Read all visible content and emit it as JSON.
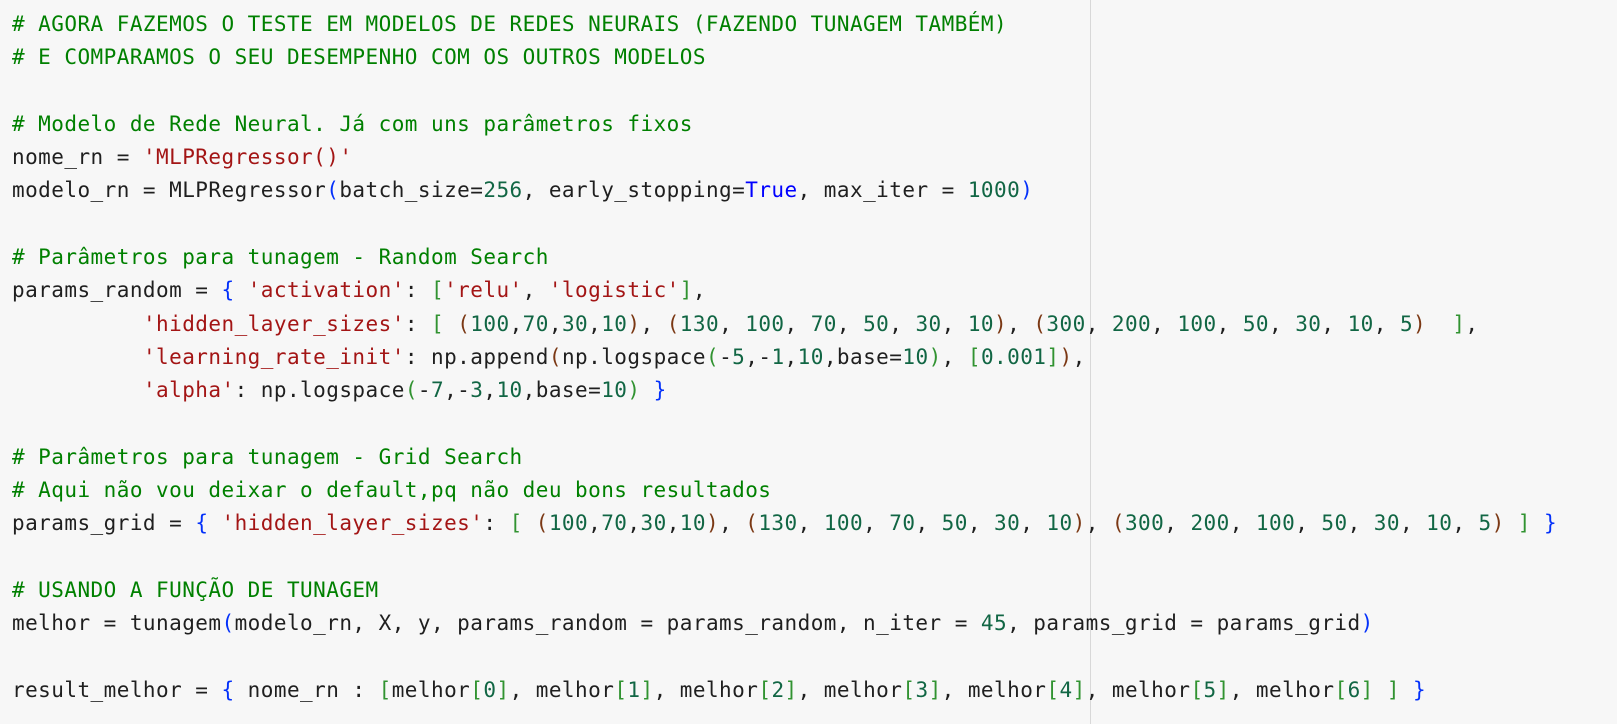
{
  "editor": {
    "lines": [
      [
        {
          "t": "comment",
          "v": "# AGORA FAZEMOS O TESTE EM MODELOS DE REDES NEURAIS (FAZENDO TUNAGEM TAMBÉM)"
        }
      ],
      [
        {
          "t": "comment",
          "v": "# E COMPARAMOS O SEU DESEMPENHO COM OS OUTROS MODELOS"
        }
      ],
      [],
      [
        {
          "t": "comment",
          "v": "# Modelo de Rede Neural. Já com uns parâmetros fixos"
        }
      ],
      [
        {
          "t": "plain",
          "v": "nome_rn = "
        },
        {
          "t": "string",
          "v": "'MLPRegressor()'"
        }
      ],
      [
        {
          "t": "plain",
          "v": "modelo_rn = MLPRegressor"
        },
        {
          "t": "brace",
          "v": "("
        },
        {
          "t": "plain",
          "v": "batch_size="
        },
        {
          "t": "number",
          "v": "256"
        },
        {
          "t": "plain",
          "v": ", early_stopping="
        },
        {
          "t": "keyword",
          "v": "True"
        },
        {
          "t": "plain",
          "v": ", max_iter = "
        },
        {
          "t": "number",
          "v": "1000"
        },
        {
          "t": "brace",
          "v": ")"
        }
      ],
      [],
      [
        {
          "t": "comment",
          "v": "# Parâmetros para tunagem - Random Search"
        }
      ],
      [
        {
          "t": "plain",
          "v": "params_random = "
        },
        {
          "t": "brace",
          "v": "{"
        },
        {
          "t": "plain",
          "v": " "
        },
        {
          "t": "string",
          "v": "'activation'"
        },
        {
          "t": "plain",
          "v": ": "
        },
        {
          "t": "bracket",
          "v": "["
        },
        {
          "t": "string",
          "v": "'relu'"
        },
        {
          "t": "plain",
          "v": ", "
        },
        {
          "t": "string",
          "v": "'logistic'"
        },
        {
          "t": "bracket",
          "v": "]"
        },
        {
          "t": "plain",
          "v": ","
        }
      ],
      [
        {
          "t": "plain",
          "v": "          "
        },
        {
          "t": "string",
          "v": "'hidden_layer_sizes'"
        },
        {
          "t": "plain",
          "v": ": "
        },
        {
          "t": "bracket",
          "v": "["
        },
        {
          "t": "plain",
          "v": " "
        },
        {
          "t": "paren",
          "v": "("
        },
        {
          "t": "number",
          "v": "100"
        },
        {
          "t": "plain",
          "v": ","
        },
        {
          "t": "number",
          "v": "70"
        },
        {
          "t": "plain",
          "v": ","
        },
        {
          "t": "number",
          "v": "30"
        },
        {
          "t": "plain",
          "v": ","
        },
        {
          "t": "number",
          "v": "10"
        },
        {
          "t": "paren",
          "v": ")"
        },
        {
          "t": "plain",
          "v": ", "
        },
        {
          "t": "paren",
          "v": "("
        },
        {
          "t": "number",
          "v": "130"
        },
        {
          "t": "plain",
          "v": ", "
        },
        {
          "t": "number",
          "v": "100"
        },
        {
          "t": "plain",
          "v": ", "
        },
        {
          "t": "number",
          "v": "70"
        },
        {
          "t": "plain",
          "v": ", "
        },
        {
          "t": "number",
          "v": "50"
        },
        {
          "t": "plain",
          "v": ", "
        },
        {
          "t": "number",
          "v": "30"
        },
        {
          "t": "plain",
          "v": ", "
        },
        {
          "t": "number",
          "v": "10"
        },
        {
          "t": "paren",
          "v": ")"
        },
        {
          "t": "plain",
          "v": ", "
        },
        {
          "t": "paren",
          "v": "("
        },
        {
          "t": "number",
          "v": "300"
        },
        {
          "t": "plain",
          "v": ", "
        },
        {
          "t": "number",
          "v": "200"
        },
        {
          "t": "plain",
          "v": ", "
        },
        {
          "t": "number",
          "v": "100"
        },
        {
          "t": "plain",
          "v": ", "
        },
        {
          "t": "number",
          "v": "50"
        },
        {
          "t": "plain",
          "v": ", "
        },
        {
          "t": "number",
          "v": "30"
        },
        {
          "t": "plain",
          "v": ", "
        },
        {
          "t": "number",
          "v": "10"
        },
        {
          "t": "plain",
          "v": ", "
        },
        {
          "t": "number",
          "v": "5"
        },
        {
          "t": "paren",
          "v": ")"
        },
        {
          "t": "plain",
          "v": "  "
        },
        {
          "t": "bracket",
          "v": "]"
        },
        {
          "t": "plain",
          "v": ","
        }
      ],
      [
        {
          "t": "plain",
          "v": "          "
        },
        {
          "t": "string",
          "v": "'learning_rate_init'"
        },
        {
          "t": "plain",
          "v": ": np.append"
        },
        {
          "t": "paren",
          "v": "("
        },
        {
          "t": "plain",
          "v": "np.logspace"
        },
        {
          "t": "bracket",
          "v": "("
        },
        {
          "t": "plain",
          "v": "-"
        },
        {
          "t": "number",
          "v": "5"
        },
        {
          "t": "plain",
          "v": ",-"
        },
        {
          "t": "number",
          "v": "1"
        },
        {
          "t": "plain",
          "v": ","
        },
        {
          "t": "number",
          "v": "10"
        },
        {
          "t": "plain",
          "v": ",base="
        },
        {
          "t": "number",
          "v": "10"
        },
        {
          "t": "bracket",
          "v": ")"
        },
        {
          "t": "plain",
          "v": ", "
        },
        {
          "t": "bracket",
          "v": "["
        },
        {
          "t": "number",
          "v": "0.001"
        },
        {
          "t": "bracket",
          "v": "]"
        },
        {
          "t": "paren",
          "v": ")"
        },
        {
          "t": "plain",
          "v": ","
        }
      ],
      [
        {
          "t": "plain",
          "v": "          "
        },
        {
          "t": "string",
          "v": "'alpha'"
        },
        {
          "t": "plain",
          "v": ": np.logspace"
        },
        {
          "t": "bracket",
          "v": "("
        },
        {
          "t": "plain",
          "v": "-"
        },
        {
          "t": "number",
          "v": "7"
        },
        {
          "t": "plain",
          "v": ",-"
        },
        {
          "t": "number",
          "v": "3"
        },
        {
          "t": "plain",
          "v": ","
        },
        {
          "t": "number",
          "v": "10"
        },
        {
          "t": "plain",
          "v": ",base="
        },
        {
          "t": "number",
          "v": "10"
        },
        {
          "t": "bracket",
          "v": ")"
        },
        {
          "t": "plain",
          "v": " "
        },
        {
          "t": "brace",
          "v": "}"
        }
      ],
      [],
      [
        {
          "t": "comment",
          "v": "# Parâmetros para tunagem - Grid Search"
        }
      ],
      [
        {
          "t": "comment",
          "v": "# Aqui não vou deixar o default,pq não deu bons resultados"
        }
      ],
      [
        {
          "t": "plain",
          "v": "params_grid = "
        },
        {
          "t": "brace",
          "v": "{"
        },
        {
          "t": "plain",
          "v": " "
        },
        {
          "t": "string",
          "v": "'hidden_layer_sizes'"
        },
        {
          "t": "plain",
          "v": ": "
        },
        {
          "t": "bracket",
          "v": "["
        },
        {
          "t": "plain",
          "v": " "
        },
        {
          "t": "paren",
          "v": "("
        },
        {
          "t": "number",
          "v": "100"
        },
        {
          "t": "plain",
          "v": ","
        },
        {
          "t": "number",
          "v": "70"
        },
        {
          "t": "plain",
          "v": ","
        },
        {
          "t": "number",
          "v": "30"
        },
        {
          "t": "plain",
          "v": ","
        },
        {
          "t": "number",
          "v": "10"
        },
        {
          "t": "paren",
          "v": ")"
        },
        {
          "t": "plain",
          "v": ", "
        },
        {
          "t": "paren",
          "v": "("
        },
        {
          "t": "number",
          "v": "130"
        },
        {
          "t": "plain",
          "v": ", "
        },
        {
          "t": "number",
          "v": "100"
        },
        {
          "t": "plain",
          "v": ", "
        },
        {
          "t": "number",
          "v": "70"
        },
        {
          "t": "plain",
          "v": ", "
        },
        {
          "t": "number",
          "v": "50"
        },
        {
          "t": "plain",
          "v": ", "
        },
        {
          "t": "number",
          "v": "30"
        },
        {
          "t": "plain",
          "v": ", "
        },
        {
          "t": "number",
          "v": "10"
        },
        {
          "t": "paren",
          "v": ")"
        },
        {
          "t": "plain",
          "v": ", "
        },
        {
          "t": "paren",
          "v": "("
        },
        {
          "t": "number",
          "v": "300"
        },
        {
          "t": "plain",
          "v": ", "
        },
        {
          "t": "number",
          "v": "200"
        },
        {
          "t": "plain",
          "v": ", "
        },
        {
          "t": "number",
          "v": "100"
        },
        {
          "t": "plain",
          "v": ", "
        },
        {
          "t": "number",
          "v": "50"
        },
        {
          "t": "plain",
          "v": ", "
        },
        {
          "t": "number",
          "v": "30"
        },
        {
          "t": "plain",
          "v": ", "
        },
        {
          "t": "number",
          "v": "10"
        },
        {
          "t": "plain",
          "v": ", "
        },
        {
          "t": "number",
          "v": "5"
        },
        {
          "t": "paren",
          "v": ")"
        },
        {
          "t": "plain",
          "v": " "
        },
        {
          "t": "bracket",
          "v": "]"
        },
        {
          "t": "plain",
          "v": " "
        },
        {
          "t": "brace",
          "v": "}"
        }
      ],
      [],
      [
        {
          "t": "comment",
          "v": "# USANDO A FUNÇÃO DE TUNAGEM"
        }
      ],
      [
        {
          "t": "plain",
          "v": "melhor = tunagem"
        },
        {
          "t": "brace",
          "v": "("
        },
        {
          "t": "plain",
          "v": "modelo_rn, X, y, params_random = params_random, n_iter = "
        },
        {
          "t": "number",
          "v": "45"
        },
        {
          "t": "plain",
          "v": ", params_grid = params_grid"
        },
        {
          "t": "brace",
          "v": ")"
        }
      ],
      [],
      [
        {
          "t": "plain",
          "v": "result_melhor = "
        },
        {
          "t": "brace",
          "v": "{"
        },
        {
          "t": "plain",
          "v": " nome_rn : "
        },
        {
          "t": "bracket",
          "v": "["
        },
        {
          "t": "plain",
          "v": "melhor"
        },
        {
          "t": "bracket",
          "v": "["
        },
        {
          "t": "number",
          "v": "0"
        },
        {
          "t": "bracket",
          "v": "]"
        },
        {
          "t": "plain",
          "v": ", melhor"
        },
        {
          "t": "bracket",
          "v": "["
        },
        {
          "t": "number",
          "v": "1"
        },
        {
          "t": "bracket",
          "v": "]"
        },
        {
          "t": "plain",
          "v": ", melhor"
        },
        {
          "t": "bracket",
          "v": "["
        },
        {
          "t": "number",
          "v": "2"
        },
        {
          "t": "bracket",
          "v": "]"
        },
        {
          "t": "plain",
          "v": ", melhor"
        },
        {
          "t": "bracket",
          "v": "["
        },
        {
          "t": "number",
          "v": "3"
        },
        {
          "t": "bracket",
          "v": "]"
        },
        {
          "t": "plain",
          "v": ", melhor"
        },
        {
          "t": "bracket",
          "v": "["
        },
        {
          "t": "number",
          "v": "4"
        },
        {
          "t": "bracket",
          "v": "]"
        },
        {
          "t": "plain",
          "v": ", melhor"
        },
        {
          "t": "bracket",
          "v": "["
        },
        {
          "t": "number",
          "v": "5"
        },
        {
          "t": "bracket",
          "v": "]"
        },
        {
          "t": "plain",
          "v": ", melhor"
        },
        {
          "t": "bracket",
          "v": "["
        },
        {
          "t": "number",
          "v": "6"
        },
        {
          "t": "bracket",
          "v": "]"
        },
        {
          "t": "plain",
          "v": " "
        },
        {
          "t": "bracket",
          "v": "]"
        },
        {
          "t": "plain",
          "v": " "
        },
        {
          "t": "brace",
          "v": "}"
        }
      ]
    ]
  },
  "colors": {
    "background": "#f7f7f7",
    "comment": "#008000",
    "string": "#a31515",
    "number": "#116644",
    "keyword": "#0000ff",
    "plain": "#1f1f1f",
    "brace": "#0431fa",
    "bracket": "#319331",
    "paren": "#7b3814"
  }
}
